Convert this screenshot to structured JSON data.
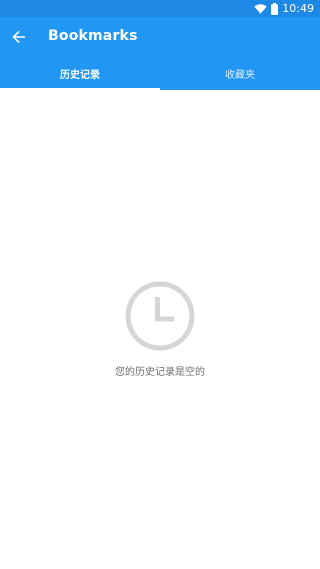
{
  "status_bar": {
    "time": "10:49",
    "icons": [
      "wifi-icon",
      "battery-icon"
    ]
  },
  "header": {
    "back_icon": "arrow-back-icon",
    "title": "Bookmarks"
  },
  "tabs": [
    {
      "label": "历史记录",
      "active": true
    },
    {
      "label": "收藏夹",
      "active": false
    }
  ],
  "empty_state": {
    "icon": "clock-icon",
    "message": "您的历史记录是空的"
  },
  "colors": {
    "status_bar": "#1e88e5",
    "app_bar": "#2196f3",
    "empty_icon": "#d6d6d6",
    "empty_text": "#6e6e6e"
  }
}
